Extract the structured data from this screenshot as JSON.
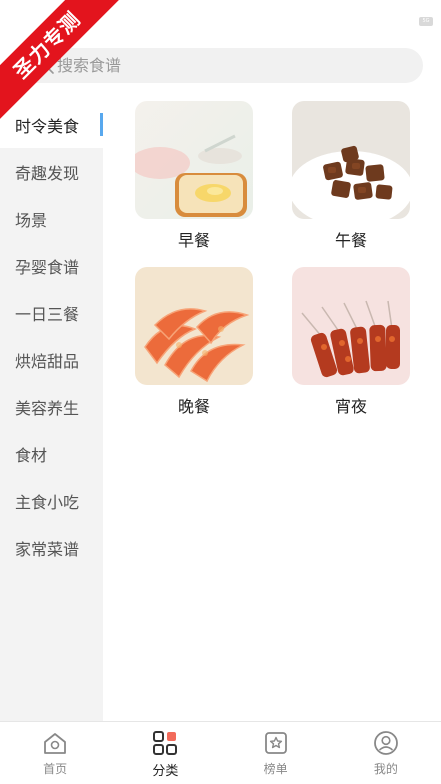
{
  "status_bar": {
    "chip_text": "5G"
  },
  "watermark": {
    "text": "圣力专测"
  },
  "search": {
    "placeholder": "搜索食谱"
  },
  "sidebar": {
    "items": [
      {
        "label": "时令美食",
        "active": true
      },
      {
        "label": "奇趣发现"
      },
      {
        "label": "场景"
      },
      {
        "label": "孕婴食谱"
      },
      {
        "label": "一日三餐"
      },
      {
        "label": "烘焙甜品"
      },
      {
        "label": "美容养生"
      },
      {
        "label": "食材"
      },
      {
        "label": "主食小吃"
      },
      {
        "label": "家常菜谱"
      }
    ]
  },
  "grid": {
    "items": [
      {
        "label": "早餐",
        "image": "toast-breakfast-photo"
      },
      {
        "label": "午餐",
        "image": "braised-pork-photo"
      },
      {
        "label": "晚餐",
        "image": "grilled-shrimp-photo"
      },
      {
        "label": "宵夜",
        "image": "skewers-photo"
      }
    ]
  },
  "tabbar": {
    "tabs": [
      {
        "label": "首页",
        "icon": "home-icon"
      },
      {
        "label": "分类",
        "icon": "category-icon",
        "active": true
      },
      {
        "label": "榜单",
        "icon": "ranking-icon"
      },
      {
        "label": "我的",
        "icon": "profile-icon"
      }
    ]
  },
  "colors": {
    "accent": "#58a8ee",
    "ribbon": "#e3141d",
    "category_dot": "#f26b5b"
  }
}
